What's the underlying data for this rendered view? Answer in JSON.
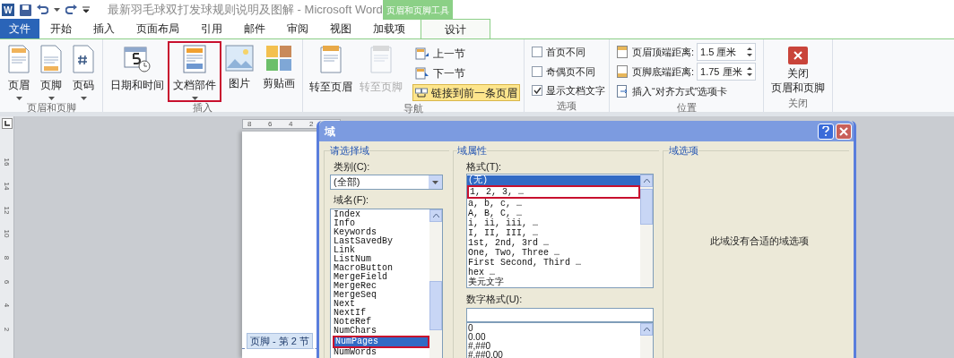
{
  "title_bar": {
    "app_logo": "W",
    "title": "最新羽毛球双打发球规则说明及图解  -  Microsoft Word",
    "context_tab_group": "页眉和页脚工具"
  },
  "tabs": [
    {
      "label": "文件",
      "kind": "file",
      "selected": false
    },
    {
      "label": "开始",
      "kind": "tab",
      "selected": false
    },
    {
      "label": "插入",
      "kind": "tab",
      "selected": false
    },
    {
      "label": "页面布局",
      "kind": "tab",
      "selected": false
    },
    {
      "label": "引用",
      "kind": "tab",
      "selected": false
    },
    {
      "label": "邮件",
      "kind": "tab",
      "selected": false
    },
    {
      "label": "审阅",
      "kind": "tab",
      "selected": false
    },
    {
      "label": "视图",
      "kind": "tab",
      "selected": false
    },
    {
      "label": "加载项",
      "kind": "tab",
      "selected": false
    },
    {
      "label": "设计",
      "kind": "context",
      "selected": true
    }
  ],
  "ribbon": [
    {
      "kind": "large",
      "label": "页眉和页脚",
      "buttons": [
        {
          "label": "页眉",
          "menu": true,
          "annotated": false
        },
        {
          "label": "页脚",
          "menu": true,
          "annotated": false
        },
        {
          "label": "页码",
          "menu": true,
          "annotated": false
        }
      ]
    },
    {
      "kind": "large",
      "label": "插入",
      "buttons": [
        {
          "label": "日期和时间",
          "menu": false,
          "annotated": false
        },
        {
          "label": "文档部件",
          "menu": true,
          "annotated": true
        },
        {
          "label": "图片",
          "menu": false,
          "annotated": false
        },
        {
          "label": "剪贴画",
          "menu": false,
          "annotated": false
        }
      ]
    },
    {
      "kind": "nav",
      "label": "导航",
      "buttons": [
        {
          "label": "转至页眉",
          "disabled": false
        },
        {
          "label": "转至页脚",
          "disabled": true
        }
      ],
      "small_buttons": [
        {
          "label": "上一节",
          "on": false
        },
        {
          "label": "下一节",
          "on": false
        },
        {
          "label": "链接到前一条页眉",
          "on": true
        }
      ]
    },
    {
      "kind": "checks",
      "label": "选项",
      "checks": [
        {
          "label": "首页不同",
          "checked": false
        },
        {
          "label": "奇偶页不同",
          "checked": false
        },
        {
          "label": "显示文档文字",
          "checked": true
        }
      ]
    },
    {
      "kind": "position",
      "label": "位置",
      "spinners": [
        {
          "label": "页眉顶端距离:",
          "value": "1.5 厘米"
        },
        {
          "label": "页脚底端距离:",
          "value": "1.75 厘米"
        }
      ],
      "link": "插入“对齐方式”选项卡"
    },
    {
      "kind": "close",
      "label": "关闭",
      "button_lines": [
        "关闭",
        "页眉和页脚"
      ]
    }
  ],
  "ruler": {
    "horizontal": [
      "8",
      "6",
      "4",
      "2"
    ],
    "vertical": [
      "16",
      "14",
      "12",
      "10",
      "8",
      "6",
      "4",
      "2"
    ]
  },
  "document": {
    "footer_tag": "页脚 - 第 2 节"
  },
  "dialog": {
    "title": "域",
    "choose": {
      "legend": "请选择域",
      "category_label": "类别(C):",
      "category_value": "(全部)",
      "names_label": "域名(F):",
      "names": [
        {
          "text": "Index",
          "selected": false,
          "annotated": false
        },
        {
          "text": "Info",
          "selected": false,
          "annotated": false
        },
        {
          "text": "Keywords",
          "selected": false,
          "annotated": false
        },
        {
          "text": "LastSavedBy",
          "selected": false,
          "annotated": false
        },
        {
          "text": "Link",
          "selected": false,
          "annotated": false
        },
        {
          "text": "ListNum",
          "selected": false,
          "annotated": false
        },
        {
          "text": "MacroButton",
          "selected": false,
          "annotated": false
        },
        {
          "text": "MergeField",
          "selected": false,
          "annotated": false
        },
        {
          "text": "MergeRec",
          "selected": false,
          "annotated": false
        },
        {
          "text": "MergeSeq",
          "selected": false,
          "annotated": false
        },
        {
          "text": "Next",
          "selected": false,
          "annotated": false
        },
        {
          "text": "NextIf",
          "selected": false,
          "annotated": false
        },
        {
          "text": "NoteRef",
          "selected": false,
          "annotated": false
        },
        {
          "text": "NumChars",
          "selected": false,
          "annotated": false
        },
        {
          "text": "NumPages",
          "selected": true,
          "annotated": true
        },
        {
          "text": "NumWords",
          "selected": false,
          "annotated": false
        }
      ]
    },
    "properties": {
      "legend": "域属性",
      "format_label": "格式(T):",
      "formats": [
        {
          "text": "(无)",
          "selected": true,
          "annotated": false
        },
        {
          "text": "1, 2, 3, …",
          "selected": false,
          "annotated": true
        },
        {
          "text": "a, b, c, …",
          "selected": false,
          "annotated": false
        },
        {
          "text": "A, B, C, …",
          "selected": false,
          "annotated": false
        },
        {
          "text": "i, ii, iii, …",
          "selected": false,
          "annotated": false
        },
        {
          "text": "I, II, III, …",
          "selected": false,
          "annotated": false
        },
        {
          "text": "1st, 2nd, 3rd …",
          "selected": false,
          "annotated": false
        },
        {
          "text": "One, Two, Three …",
          "selected": false,
          "annotated": false
        },
        {
          "text": "First Second, Third …",
          "selected": false,
          "annotated": false
        },
        {
          "text": "hex …",
          "selected": false,
          "annotated": false
        },
        {
          "text": "美元文字",
          "selected": false,
          "annotated": false
        }
      ],
      "number_format_label": "数字格式(U):",
      "number_formats": [
        "0",
        "0.00",
        "#,##0",
        "#,##0.00"
      ]
    },
    "options": {
      "legend": "域选项",
      "message": "此域没有合适的域选项"
    }
  }
}
